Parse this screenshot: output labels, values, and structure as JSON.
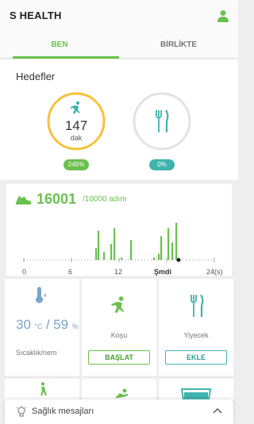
{
  "app": {
    "title": "S HEALTH"
  },
  "tabs": [
    {
      "label": "BEN",
      "active": true
    },
    {
      "label": "BİRLİKTE",
      "active": false
    }
  ],
  "goals": {
    "title": "Hedefler",
    "activity": {
      "icon": "running-icon",
      "value": "147",
      "unit": "dak",
      "badge": "245%",
      "progress": 1.0,
      "color": "#f5c23a"
    },
    "food": {
      "icon": "fork-knife-icon",
      "badge": "0%",
      "progress": 0,
      "color": "#3fb4ad"
    }
  },
  "steps": {
    "icon": "shoe-icon",
    "count": "16001",
    "goal": "/10000 adım",
    "axis_labels": [
      "0",
      "6",
      "12",
      "Şmdi",
      "24(s)"
    ]
  },
  "chart_data": {
    "type": "bar",
    "xlim": [
      0,
      24
    ],
    "x": [
      9.1,
      9.4,
      10.1,
      11.0,
      11.4,
      12.3,
      13.5,
      16.4,
      17.0,
      17.3,
      18.2,
      18.7,
      19.2
    ],
    "values": [
      15,
      37,
      10,
      20,
      40,
      3,
      25,
      3,
      8,
      30,
      40,
      22,
      47
    ]
  },
  "tiles": {
    "weather": {
      "icon": "thermometer-icon",
      "temp": "30",
      "temp_unit": "°C",
      "separator": "/",
      "humidity": "59",
      "humidity_unit": "%",
      "label": "Sıcaklık/nem"
    },
    "running": {
      "icon": "running-icon",
      "title": "Koşu",
      "button": "BAŞLAT"
    },
    "food": {
      "icon": "fork-knife-icon",
      "title": "Yiyecek",
      "button": "EKLE"
    },
    "row2": [
      "walking-icon",
      "activity-icon",
      "water-icon"
    ]
  },
  "health_messages": {
    "label": "Sağlık mesajları",
    "icon": "lightbulb-icon"
  },
  "colors": {
    "accent": "#6ac04e",
    "teal": "#3fb4ad",
    "yellow": "#f5c23a",
    "weather_blue": "#7aa5c9"
  }
}
